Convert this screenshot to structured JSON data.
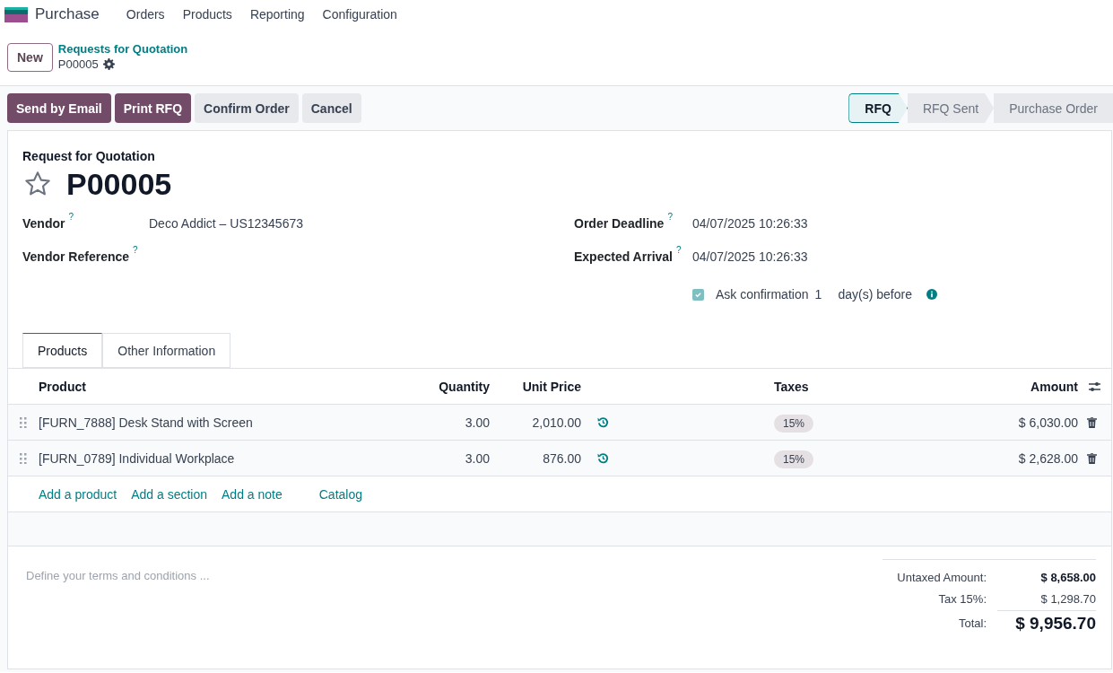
{
  "nav": {
    "app": "Purchase",
    "menu": [
      "Orders",
      "Products",
      "Reporting",
      "Configuration"
    ]
  },
  "breadcrumb": {
    "new_button": "New",
    "parent": "Requests for Quotation",
    "current": "P00005"
  },
  "actions": [
    {
      "label": "Send by Email",
      "kind": "primary"
    },
    {
      "label": "Print RFQ",
      "kind": "primary"
    },
    {
      "label": "Confirm Order",
      "kind": "secondary"
    },
    {
      "label": "Cancel",
      "kind": "secondary"
    }
  ],
  "status_bar": [
    {
      "label": "RFQ",
      "selected": true
    },
    {
      "label": "RFQ Sent",
      "selected": false
    },
    {
      "label": "Purchase Order",
      "selected": false
    }
  ],
  "form": {
    "type_label": "Request for Quotation",
    "title": "P00005",
    "starred": false,
    "fields_left": [
      {
        "label": "Vendor",
        "help": "?",
        "value": "Deco Addict – US12345673"
      },
      {
        "label": "Vendor Reference",
        "help": "?"
      }
    ],
    "fields_right": [
      {
        "label": "Order Deadline",
        "help": "?",
        "value": "04/07/2025 10:26:33"
      },
      {
        "label": "Expected Arrival",
        "help": "?",
        "value": "04/07/2025 10:26:33"
      }
    ],
    "confirmation": {
      "checked": true,
      "label": "Ask confirmation",
      "days": "1",
      "suffix": "day(s) before"
    }
  },
  "tabs": [
    {
      "label": "Products",
      "selected": true
    },
    {
      "label": "Other Information",
      "selected": false
    }
  ],
  "table": {
    "columns": [
      "Product",
      "Quantity",
      "Unit Price",
      "Taxes",
      "Amount"
    ],
    "rows": [
      {
        "product": "[FURN_7888] Desk Stand with Screen",
        "quantity": "3.00",
        "unit_price": "2,010.00",
        "tax": "15%",
        "amount": "$ 6,030.00"
      },
      {
        "product": "[FURN_0789] Individual Workplace",
        "quantity": "3.00",
        "unit_price": "876.00",
        "tax": "15%",
        "amount": "$ 2,628.00"
      }
    ],
    "add_links": [
      "Add a product",
      "Add a section",
      "Add a note",
      "Catalog"
    ]
  },
  "terms": {
    "placeholder": "Define your terms and conditions ..."
  },
  "totals": [
    {
      "label": "Untaxed Amount:",
      "value": "$ 8,658.00",
      "kind": "subtotal"
    },
    {
      "label": "Tax 15%:",
      "value": "$ 1,298.70",
      "kind": "tax"
    },
    {
      "label": "Total:",
      "value": "$ 9,956.70",
      "kind": "total"
    }
  ]
}
